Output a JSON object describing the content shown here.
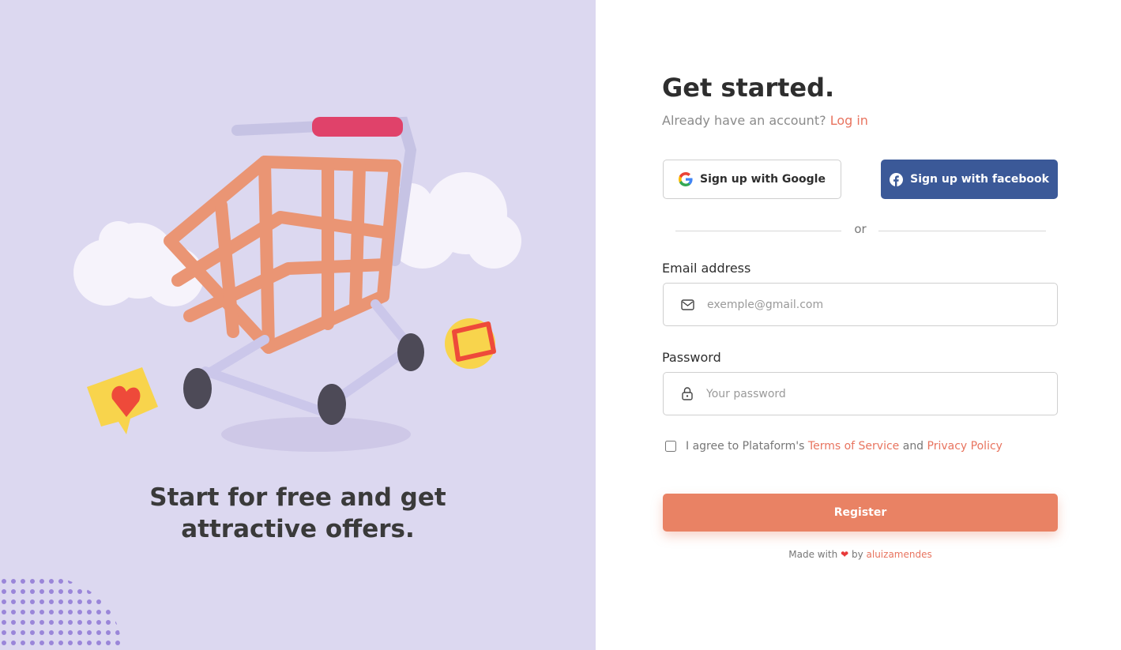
{
  "left": {
    "tagline_line1": "Start for free and get",
    "tagline_line2": "attractive offers."
  },
  "form": {
    "title": "Get started.",
    "subtitle_prefix": "Already have an account?",
    "login_link": "Log in",
    "google_button": "Sign up with Google",
    "facebook_button": "Sign up with facebook",
    "divider_text": "or",
    "email_label": "Email address",
    "email_placeholder": "exemple@gmail.com",
    "password_label": "Password",
    "password_placeholder": "Your password",
    "agree_prefix": "I agree to Plataform's",
    "terms_link": "Terms of Service",
    "agree_and": "and",
    "privacy_link": "Privacy Policy",
    "register_button": "Register"
  },
  "footer": {
    "made_with": "Made with",
    "heart": "❤",
    "by": "by",
    "author": "aluizamendes"
  },
  "colors": {
    "left_bg": "#dcd8f0",
    "accent": "#e98264",
    "facebook": "#3b5998"
  },
  "icons": [
    "google-icon",
    "facebook-icon",
    "mail-icon",
    "lock-icon",
    "heart-icon",
    "thumbs-up-icon",
    "cart-illustration"
  ]
}
